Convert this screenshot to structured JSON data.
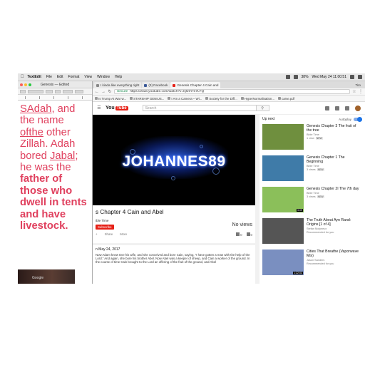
{
  "menubar": {
    "app": "TextEdit",
    "items": [
      "File",
      "Edit",
      "Format",
      "View",
      "Window",
      "Help"
    ],
    "battery": "38%",
    "datetime": "Wed May 24  11:00:51"
  },
  "textedit": {
    "title": "Genesis — Edited",
    "seg1": "SAdah",
    "seg2": ", and the name ",
    "seg3": "ofthe",
    "seg4": " other Zillah. Adah bored ",
    "seg5": "Jabal",
    "seg6": "; he was the ",
    "seg7": "father of those who dwell in tents and have livestock."
  },
  "browser": {
    "tabs": [
      {
        "label": "I kinda like everything right"
      },
      {
        "label": "(3) Facebook"
      },
      {
        "label": "Genesis Chapter 4 Cain and"
      }
    ],
    "profile": "Tim",
    "url_secure": "Secure",
    "url": "https://www.youtube.com/watch?v=kjfJ0Ym7LYQ",
    "bookmarks": [
      "Is Trump At War w...",
      "STARSHIP GENIUS...",
      "I Am a Camera – Wi...",
      "Society for the Diff...",
      "HyperNormalisation...",
      "carse.pdf"
    ]
  },
  "youtube": {
    "logo_text": "You",
    "logo_red": "Tube",
    "search_placeholder": "Search",
    "video_title": "s Chapter 4 Cain and Abel",
    "watermark": "JOHANNES89",
    "channel": "ible Time",
    "subscribe": "Subscribe",
    "views": "No views",
    "actions": [
      "Share",
      "More"
    ],
    "likes": "0",
    "dislikes": "0",
    "published": "n May 24, 2017",
    "description": "Now Adam knew Eve his wife, and she conceived and bore Cain, saying, \"I have gotten a man with the help of the Lord.\" And again, she bore his brother Abel. Now Abel was a keeper of sheep, and Cain a worker of the ground. In the course of time Cain brought to the Lord an offering of the fruit of the ground, and Abel",
    "upnext_label": "Up next",
    "autoplay_label": "Autoplay",
    "recommendations": [
      {
        "title": "Genesis Chapter 3 The fruit of the tree",
        "channel": "Bible Time",
        "meta": "1 view",
        "badge": "NEW",
        "duration": "",
        "thumb": "#6f8f3e"
      },
      {
        "title": "Genesis Chapter 1 The Beginning",
        "channel": "Bible Time",
        "meta": "3 views",
        "badge": "NEW",
        "duration": "",
        "thumb": "#3f7ba8"
      },
      {
        "title": "Genesis Chapter 2I The 7th day",
        "channel": "Bible Time",
        "meta": "3 views",
        "badge": "NEW",
        "duration": "3:09",
        "thumb": "#8bbf5a"
      },
      {
        "title": "The Truth About Ayn Rand: Origins [1 of 4]",
        "channel": "Stefan Molyneux",
        "meta": "Recommended for you",
        "badge": "",
        "duration": "",
        "thumb": "#555555"
      },
      {
        "title": "Cities That Breathe (Vaporwave Mix)",
        "channel": "Jason Sanders",
        "meta": "Recommended for you",
        "badge": "",
        "duration": "1:22:03",
        "thumb": "#7a8fc0"
      }
    ]
  },
  "desktop_label": "Google",
  "colors": {
    "textedit_text": "#e0405e",
    "youtube_red": "#e62117",
    "accent_blue": "#1a73e8"
  }
}
